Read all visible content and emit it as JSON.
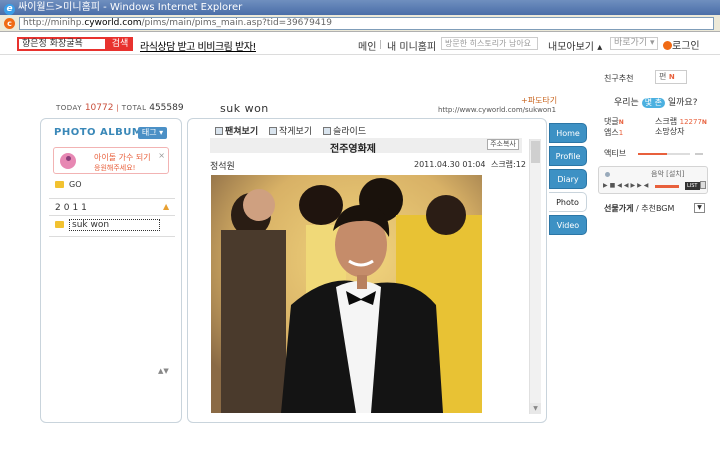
{
  "window": {
    "title": "싸이월드>미니홈피 - Windows Internet Explorer",
    "url_prefix": "http://minihp.",
    "url_domain": "cyworld.com",
    "url_path": "/pims/main/pims_main.asp?tid=39679419"
  },
  "topnav": {
    "search_value": "향은정 화장굴욕",
    "search_button": "검색",
    "promo": "라식상담 받고 비비크림 받자!",
    "main": "메인",
    "my_minihompy": "내 미니홈피",
    "history": "방문한 히스토리가 남아요",
    "my_collection": "내모아보기",
    "goto": "바로가기",
    "login": "로그인"
  },
  "header": {
    "today_label": "TODAY",
    "today_count": "10772",
    "total_label": "TOTAL",
    "total_count": "455589",
    "owner": "suk won",
    "paper_link": "파도타기",
    "home_url": "http://www.cyworld.com/sukwon1"
  },
  "left_panel": {
    "title": "PHOTO ALBUM",
    "tag_button": "태그",
    "notice_line1": "아이돌 가수 되기",
    "notice_line2": "응원해주세요!",
    "notice_close": "×",
    "folders": [
      {
        "label": "GO"
      }
    ],
    "year": "2011",
    "year_toggle": "▲",
    "year_folders": [
      {
        "label": "suk won"
      }
    ]
  },
  "main_panel": {
    "view_tabs": [
      "팬쳐보기",
      "작게보기",
      "슬라이드"
    ],
    "post_title": "전주영화제",
    "copy_url": "주소복사",
    "writer": "정석원",
    "date": "2011.04.30 01:04",
    "scrap": "스크랩:12"
  },
  "side_tabs": [
    {
      "label": "Home",
      "active": false
    },
    {
      "label": "Profile",
      "active": false
    },
    {
      "label": "Diary",
      "active": false
    },
    {
      "label": "Photo",
      "active": true
    },
    {
      "label": "Video",
      "active": false
    }
  ],
  "right_panel": {
    "friend_recommend": "친구추천",
    "friend_box": "편",
    "new_badge": "N",
    "question_pre": "우리는",
    "question_pill": "몇 촌",
    "question_post": "일까요?",
    "stats": [
      {
        "label": "댓글",
        "badge": "N",
        "right_label": "스크랩",
        "right_badge": "N",
        "right_value": "12277"
      },
      {
        "label": "앱스",
        "badge": "",
        "right_value_small": "1",
        "right_label": "소망상자",
        "right_badge": "",
        "right_value": ""
      }
    ],
    "active_label": "액티브",
    "active_level": 0.55,
    "music_label": "음악 [설치]",
    "list_label": "LIST",
    "bgm_label_bold": "선물가게",
    "bgm_label_rest": " / 추천BGM",
    "bgm_toggle": "▼"
  },
  "colors": {
    "accent": "#3d91c4",
    "search_red": "#e8322e",
    "orange": "#e8603c"
  }
}
